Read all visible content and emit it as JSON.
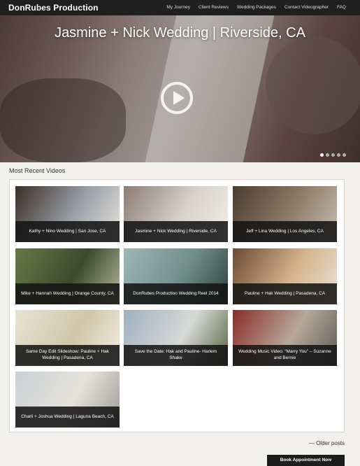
{
  "header": {
    "brand": "DonRubes Production",
    "nav": [
      "My Journey",
      "Client Reviews",
      "Wedding Packages",
      "Contact Videographer",
      "FAQ"
    ]
  },
  "hero": {
    "title": "Jasmine + Nick Wedding | Riverside, CA",
    "slides_total": 5,
    "active_slide": 1
  },
  "recent": {
    "heading": "Most Recent Videos",
    "videos": [
      {
        "title": "Kathy + Nino Wedding | San Jose, CA",
        "thumb_colors": [
          "#3b2e26",
          "#9aa0a8",
          "#e8e4dc"
        ]
      },
      {
        "title": "Jasmine + Nick Wedding | Riverside, CA",
        "thumb_colors": [
          "#8c7c72",
          "#d8d2cc",
          "#f2eee8"
        ]
      },
      {
        "title": "Jeff + Lina Wedding | Los Angeles, CA",
        "thumb_colors": [
          "#4a3b30",
          "#8f7d6a",
          "#c8bfb5"
        ]
      },
      {
        "title": "Mike + Hannah Wedding | Orange County, CA",
        "thumb_colors": [
          "#667a48",
          "#3b4a2c",
          "#b7b9a0"
        ]
      },
      {
        "title": "DonRubes Production Wedding Reel 2014",
        "thumb_colors": [
          "#9fb7b8",
          "#6f8e89",
          "#2f3f3a"
        ]
      },
      {
        "title": "Pauline + Hak Wedding | Pasadena, CA",
        "thumb_colors": [
          "#6b4a34",
          "#d6b48c",
          "#e9e2d8"
        ]
      },
      {
        "title": "Same Day Edit Slideshow: Pauline + Hak Wedding | Pasadena, CA",
        "thumb_colors": [
          "#e8e3d6",
          "#d1c6a8",
          "#f4efe6"
        ]
      },
      {
        "title": "Save the Date: Hak and Pauline- Harlem Shake",
        "thumb_colors": [
          "#9fb0c2",
          "#d7d9d6",
          "#56613c"
        ]
      },
      {
        "title": "Wedding Music Video: “Marry You” – Suzanne and Bernie",
        "thumb_colors": [
          "#8a2d28",
          "#b7a89a",
          "#5d5a52"
        ]
      },
      {
        "title": "Charli + Joshua Wedding | Laguna Beach, CA",
        "thumb_colors": [
          "#c9d1d6",
          "#e6e2da",
          "#9b9a94"
        ]
      }
    ]
  },
  "pagination": {
    "older": "— Older posts"
  },
  "cta": {
    "label": "Book Appointment Now"
  }
}
